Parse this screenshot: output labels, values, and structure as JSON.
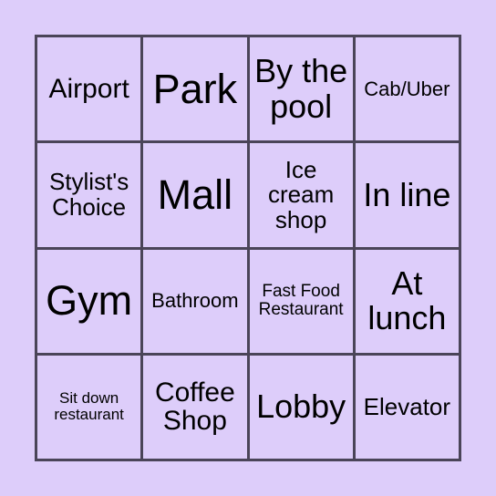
{
  "card": {
    "type": "bingo-card",
    "rows": 4,
    "columns": 4,
    "colors": {
      "page_background": "#ddcdfa",
      "cell_background": "#ddcdfa",
      "grid_line": "#4a4458",
      "text": "#000000"
    },
    "cells": [
      {
        "label": "Airport",
        "size": "md"
      },
      {
        "label": "Park",
        "size": "xl"
      },
      {
        "label": "By the pool",
        "size": "lg"
      },
      {
        "label": "Cab/Uber",
        "size": "xs"
      },
      {
        "label": "Stylist's Choice",
        "size": "sm"
      },
      {
        "label": "Mall",
        "size": "xl"
      },
      {
        "label": "Ice cream shop",
        "size": "sm"
      },
      {
        "label": "In line",
        "size": "lg"
      },
      {
        "label": "Gym",
        "size": "xl"
      },
      {
        "label": "Bathroom",
        "size": "xs"
      },
      {
        "label": "Fast Food Restaurant",
        "size": "xxs"
      },
      {
        "label": "At lunch",
        "size": "lg"
      },
      {
        "label": "Sit down restaurant",
        "size": "tiny"
      },
      {
        "label": "Coffee Shop",
        "size": "md"
      },
      {
        "label": "Lobby",
        "size": "lg"
      },
      {
        "label": "Elevator",
        "size": "sm"
      }
    ]
  }
}
